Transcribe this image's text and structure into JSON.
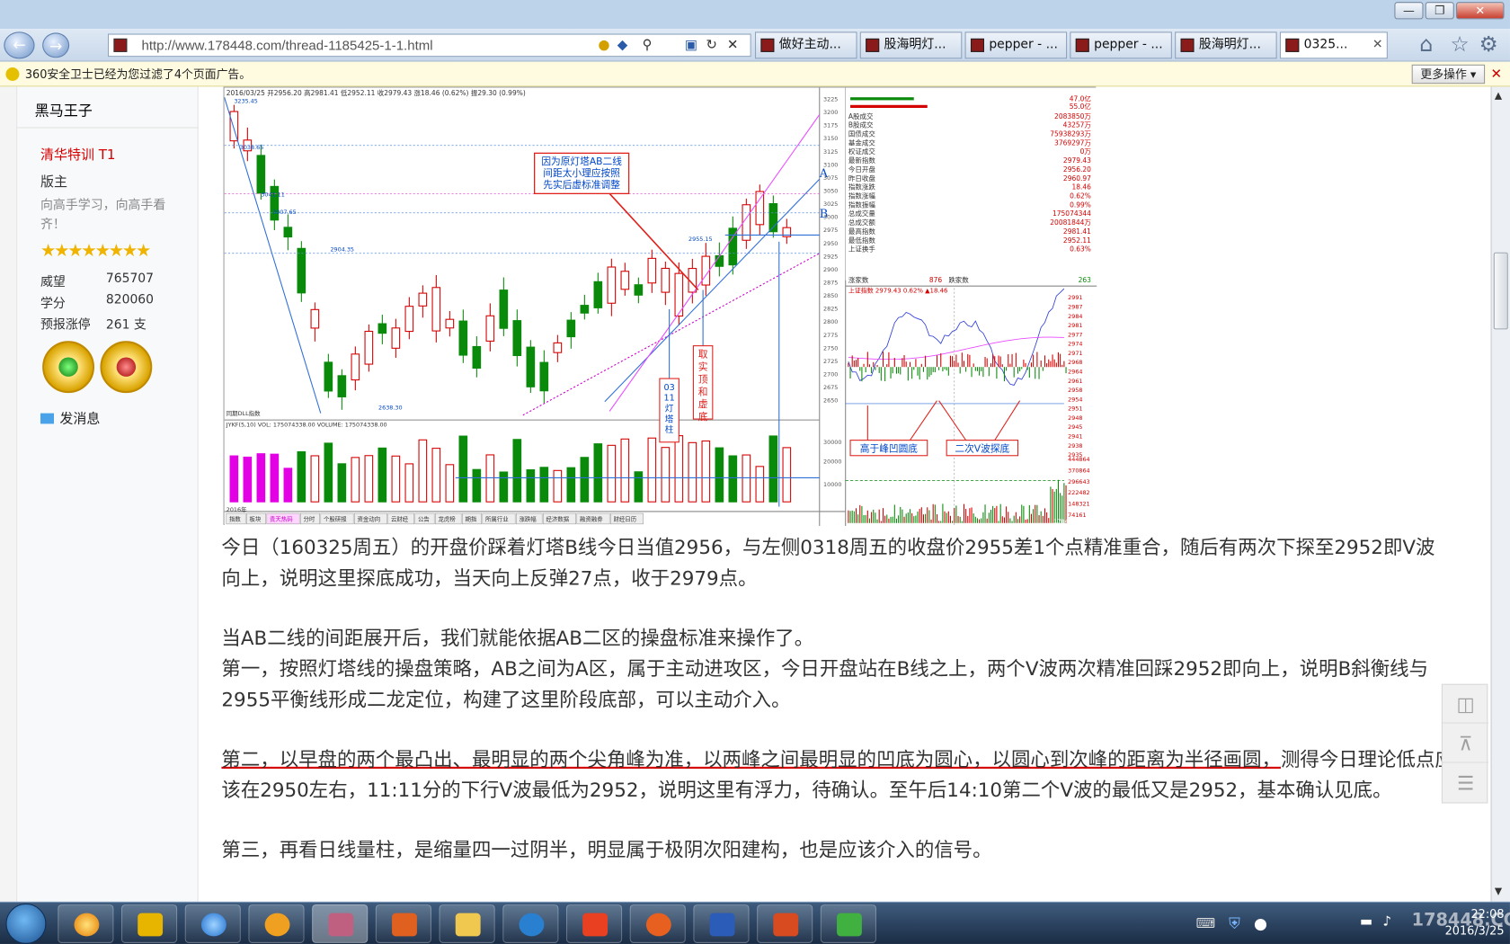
{
  "browser": {
    "url": "http://www.178448.com/thread-1185425-1-1.html",
    "tabs": [
      {
        "label": "做好主动..."
      },
      {
        "label": "股海明灯..."
      },
      {
        "label": "pepper - ..."
      },
      {
        "label": "pepper - ..."
      },
      {
        "label": "股海明灯..."
      },
      {
        "label": "0325...",
        "active": true
      }
    ]
  },
  "notice": {
    "text": "360安全卫士已经为您过滤了4个页面广告。",
    "more_label": "更多操作 ▾"
  },
  "profile": {
    "username": "黑马王子",
    "group": "清华特训   T1",
    "role": "版主",
    "motto": "向高手学习，向高手看齐！",
    "stars": "★★★★★★★★",
    "stats": [
      {
        "label": "威望",
        "value": "765707"
      },
      {
        "label": "学分",
        "value": "820060"
      },
      {
        "label": "预报涨停",
        "value": "261 支"
      }
    ],
    "message_label": "发消息"
  },
  "chart": {
    "kline_annotation": "因为原灯塔AB二线\n间距太小理应按照\n先实后虚标准调整",
    "label_A": "A",
    "label_B": "B",
    "vertical_note_1": "03\n11\n灯\n塔\n柱",
    "vertical_note_2": "取\n实\n顶\n和\n虚\n底",
    "intraday_note_1": "高于峰凹圆底",
    "intraday_note_2": "二次V波探底",
    "left_prices": [
      "3235.45",
      "3038.65",
      "3041.11",
      "3007.65",
      "2955.15",
      "2904.35",
      "2638.30"
    ],
    "right_axis": [
      "3225",
      "3200",
      "3175",
      "3150",
      "3125",
      "3100",
      "3075",
      "3050",
      "3025",
      "3000",
      "2975",
      "2950",
      "2925",
      "2900",
      "2875",
      "2850",
      "2825",
      "2800",
      "2775",
      "2750",
      "2725",
      "2700",
      "2675",
      "2650"
    ],
    "vol_axis": [
      "30000",
      "20000",
      "10000"
    ],
    "info_table": [
      {
        "label": "A股成交",
        "value": "2083850万"
      },
      {
        "label": "B股成交",
        "value": "43257万"
      },
      {
        "label": "国债成交",
        "value": "75938293万"
      },
      {
        "label": "基金成交",
        "value": "3769297万"
      },
      {
        "label": "权证成交",
        "value": "0万"
      },
      {
        "label": "最新指数",
        "value": "2979.43"
      },
      {
        "label": "今日开盘",
        "value": "2956.20"
      },
      {
        "label": "昨日收盘",
        "value": "2960.97"
      },
      {
        "label": "指数涨跌",
        "value": "18.46"
      },
      {
        "label": "指数涨幅",
        "value": "0.62%"
      },
      {
        "label": "指数振幅",
        "value": "0.99%"
      },
      {
        "label": "总成交量",
        "value": "175074344"
      },
      {
        "label": "总成交额",
        "value": "20081844万"
      },
      {
        "label": "最高指数",
        "value": "2981.41"
      },
      {
        "label": "最低指数",
        "value": "2952.11"
      },
      {
        "label": "上证换手",
        "value": "0.63%"
      }
    ],
    "up_count_label": "涨家数",
    "up_count": "876",
    "down_count_label": "跌家数",
    "down_count": "263",
    "top_pct_1": "47.0亿",
    "top_pct_2": "55.0亿",
    "intraday_header": "上证指数  2979.43  0.62%  ▲18.46",
    "intraday_right": [
      "2991",
      "2987",
      "2984",
      "2981",
      "2977",
      "2974",
      "2971",
      "2968",
      "2964",
      "2961",
      "2958",
      "2954",
      "2951",
      "2948",
      "2945",
      "2941",
      "2938",
      "2935"
    ],
    "intraday_vol": [
      "444864",
      "370864",
      "296643",
      "222482",
      "148321",
      "74161"
    ],
    "kline_bottom_label": "同期DLL指数",
    "vol_label": "JYKF(5,10)  VOL: 175074338.00  VOLUME: 175074338.00",
    "bottom_tabs": [
      "指数",
      "板块",
      "贵天热码",
      "分时",
      "个股研报",
      "资金动向",
      "云财经",
      "公告",
      "龙虎榜",
      "期指",
      "所属行业",
      "涨跌幅",
      "经济数据",
      "融资融券",
      "财经日历"
    ],
    "date_label": "2016年",
    "site_mark": "178448.COM",
    "header_text": "2016/03/25 开2956.20 高2981.41 低2952.11 收2979.43 涨18.46 (0.62%) 振29.30 (0.99%)"
  },
  "post_body": {
    "p1": "今日（160325周五）的开盘价踩着灯塔B线今日当值2956，与左侧0318周五的收盘价2955差1个点精准重合，随后有两次下探至2952即V波向上，说明这里探底成功，当天向上反弹27点，收于2979点。",
    "p2": "当AB二线的间距展开后，我们就能依据AB二区的操盘标准来操作了。",
    "p3": "第一，按照灯塔线的操盘策略，AB之间为A区，属于主动进攻区，今日开盘站在B线之上，两个V波两次精准回踩2952即向上，说明B斜衡线与2955平衡线形成二龙定位，构建了这里阶段底部，可以主动介入。",
    "p4_underlined": "第二，以早盘的两个最凸出、最明显的两个尖角峰为准，以两峰之间最明显的凹底为圆心，以圆心到次峰的距离为半径画圆，",
    "p4_rest": "测得今日理论低点应该在2950左右，11:11分的下行V波最低为2952，说明这里有浮力，待确认。至午后14:10第二个V波的最低又是2952，基本确认见底。",
    "p5": "第三，再看日线量柱，是缩量四一过阴半，明显属于极阴次阳建构，也是应该介入的信号。"
  },
  "taskbar": {
    "time": "22:08",
    "date": "2016/3/25",
    "watermark": "178448.COM"
  }
}
